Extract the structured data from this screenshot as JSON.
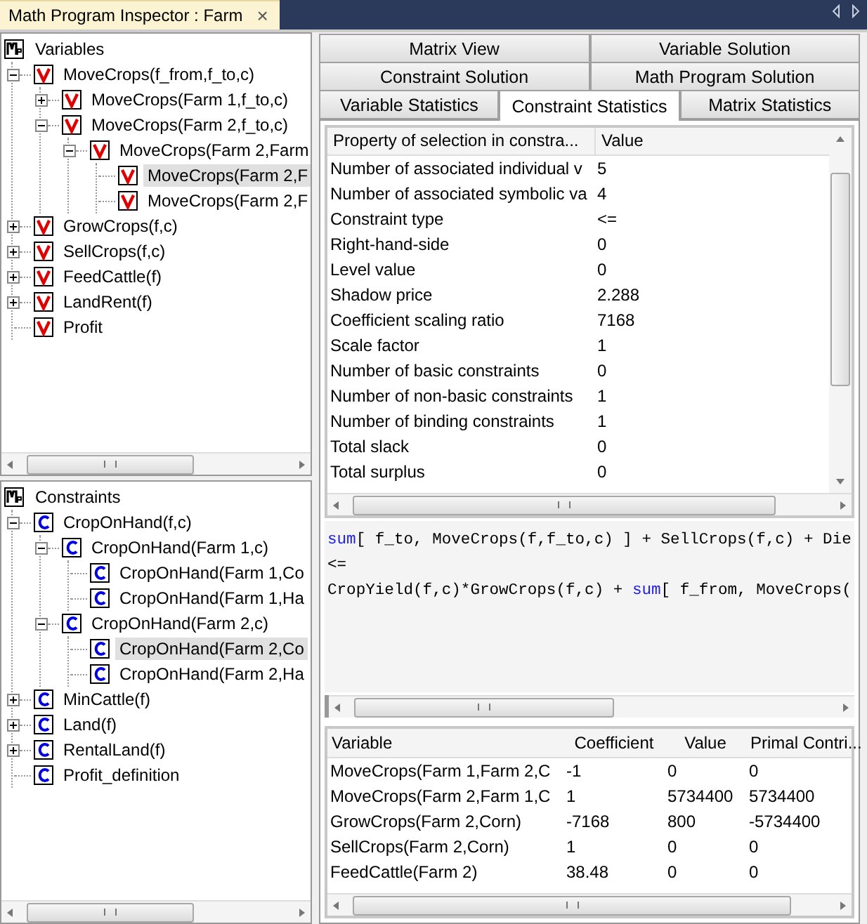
{
  "document_tab": {
    "title": "Math Program Inspector : Farm",
    "close": "×"
  },
  "variables_tree": {
    "title": "Variables",
    "items": [
      {
        "label": "MoveCrops(f_from,f_to,c)",
        "kind": "variable",
        "expanded": true,
        "selected": false,
        "children": [
          {
            "label": "MoveCrops(Farm 1,f_to,c)",
            "kind": "variable",
            "expanded": false,
            "selected": false
          },
          {
            "label": "MoveCrops(Farm 2,f_to,c)",
            "kind": "variable",
            "expanded": true,
            "selected": false,
            "children": [
              {
                "label": "MoveCrops(Farm 2,Farm",
                "kind": "variable",
                "expanded": true,
                "selected": false,
                "children": [
                  {
                    "label": "MoveCrops(Farm 2,F",
                    "kind": "variable",
                    "selected": true
                  },
                  {
                    "label": "MoveCrops(Farm 2,F",
                    "kind": "variable",
                    "selected": false
                  }
                ]
              }
            ]
          }
        ]
      },
      {
        "label": "GrowCrops(f,c)",
        "kind": "variable",
        "expanded": false,
        "selected": false
      },
      {
        "label": "SellCrops(f,c)",
        "kind": "variable",
        "expanded": false,
        "selected": false
      },
      {
        "label": "FeedCattle(f)",
        "kind": "variable",
        "expanded": false,
        "selected": false
      },
      {
        "label": "LandRent(f)",
        "kind": "variable",
        "expanded": false,
        "selected": false
      },
      {
        "label": "Profit",
        "kind": "variable",
        "selected": false
      }
    ]
  },
  "constraints_tree": {
    "title": "Constraints",
    "items": [
      {
        "label": "CropOnHand(f,c)",
        "kind": "constraint",
        "expanded": true,
        "selected": false,
        "children": [
          {
            "label": "CropOnHand(Farm 1,c)",
            "kind": "constraint",
            "expanded": true,
            "selected": false,
            "children": [
              {
                "label": "CropOnHand(Farm 1,Co",
                "kind": "constraint",
                "selected": false
              },
              {
                "label": "CropOnHand(Farm 1,Ha",
                "kind": "constraint",
                "selected": false
              }
            ]
          },
          {
            "label": "CropOnHand(Farm 2,c)",
            "kind": "constraint",
            "expanded": true,
            "selected": false,
            "children": [
              {
                "label": "CropOnHand(Farm 2,Co",
                "kind": "constraint",
                "selected": true
              },
              {
                "label": "CropOnHand(Farm 2,Ha",
                "kind": "constraint",
                "selected": false
              }
            ]
          }
        ]
      },
      {
        "label": "MinCattle(f)",
        "kind": "constraint",
        "expanded": false,
        "selected": false
      },
      {
        "label": "Land(f)",
        "kind": "constraint",
        "expanded": false,
        "selected": false
      },
      {
        "label": "RentalLand(f)",
        "kind": "constraint",
        "expanded": false,
        "selected": false
      },
      {
        "label": "Profit_definition",
        "kind": "constraint",
        "selected": false
      }
    ]
  },
  "tab_rows": [
    [
      {
        "label": "Matrix View",
        "selected": false
      },
      {
        "label": "Variable Solution",
        "selected": false
      }
    ],
    [
      {
        "label": "Constraint Solution",
        "selected": false
      },
      {
        "label": "Math Program Solution",
        "selected": false
      }
    ],
    [
      {
        "label": "Variable Statistics",
        "selected": false
      },
      {
        "label": "Constraint Statistics",
        "selected": true
      },
      {
        "label": "Matrix Statistics",
        "selected": false
      }
    ]
  ],
  "properties": {
    "columns": [
      "Property of selection in constra...",
      "Value"
    ],
    "rows": [
      [
        "Number of associated individual v",
        "5"
      ],
      [
        "Number of associated symbolic va",
        "4"
      ],
      [
        "Constraint type",
        "<="
      ],
      [
        "Right-hand-side",
        "0"
      ],
      [
        "Level value",
        "0"
      ],
      [
        "Shadow price",
        "2.288"
      ],
      [
        "Coefficient scaling ratio",
        "7168"
      ],
      [
        "Scale factor",
        "1"
      ],
      [
        "Number of basic constraints",
        "0"
      ],
      [
        "Number of non-basic constraints",
        "1"
      ],
      [
        "Number of binding constraints",
        "1"
      ],
      [
        "Total slack",
        "0"
      ],
      [
        "Total surplus",
        "0"
      ]
    ]
  },
  "formula": [
    [
      {
        "kind": "keyword",
        "text": "sum"
      },
      {
        "kind": "text",
        "text": "[ f_to, MoveCrops(f,f_to,c) ] + SellCrops(f,c) + Die"
      }
    ],
    [
      {
        "kind": "text",
        "text": "<="
      }
    ],
    [
      {
        "kind": "text",
        "text": "CropYield(f,c)*GrowCrops(f,c) + "
      },
      {
        "kind": "keyword",
        "text": "sum"
      },
      {
        "kind": "text",
        "text": "[ f_from, MoveCrops("
      }
    ]
  ],
  "terms": {
    "columns": [
      "Variable",
      "Coefficient",
      "Value",
      "Primal Contri..."
    ],
    "rows": [
      [
        "MoveCrops(Farm 1,Farm 2,C",
        "-1",
        "0",
        "0"
      ],
      [
        "MoveCrops(Farm 2,Farm 1,C",
        "1",
        "5734400",
        "5734400"
      ],
      [
        "GrowCrops(Farm 2,Corn)",
        "-7168",
        "800",
        "-5734400"
      ],
      [
        "SellCrops(Farm 2,Corn)",
        "1",
        "0",
        "0"
      ],
      [
        "FeedCattle(Farm 2)",
        "38.48",
        "0",
        "0"
      ]
    ]
  }
}
